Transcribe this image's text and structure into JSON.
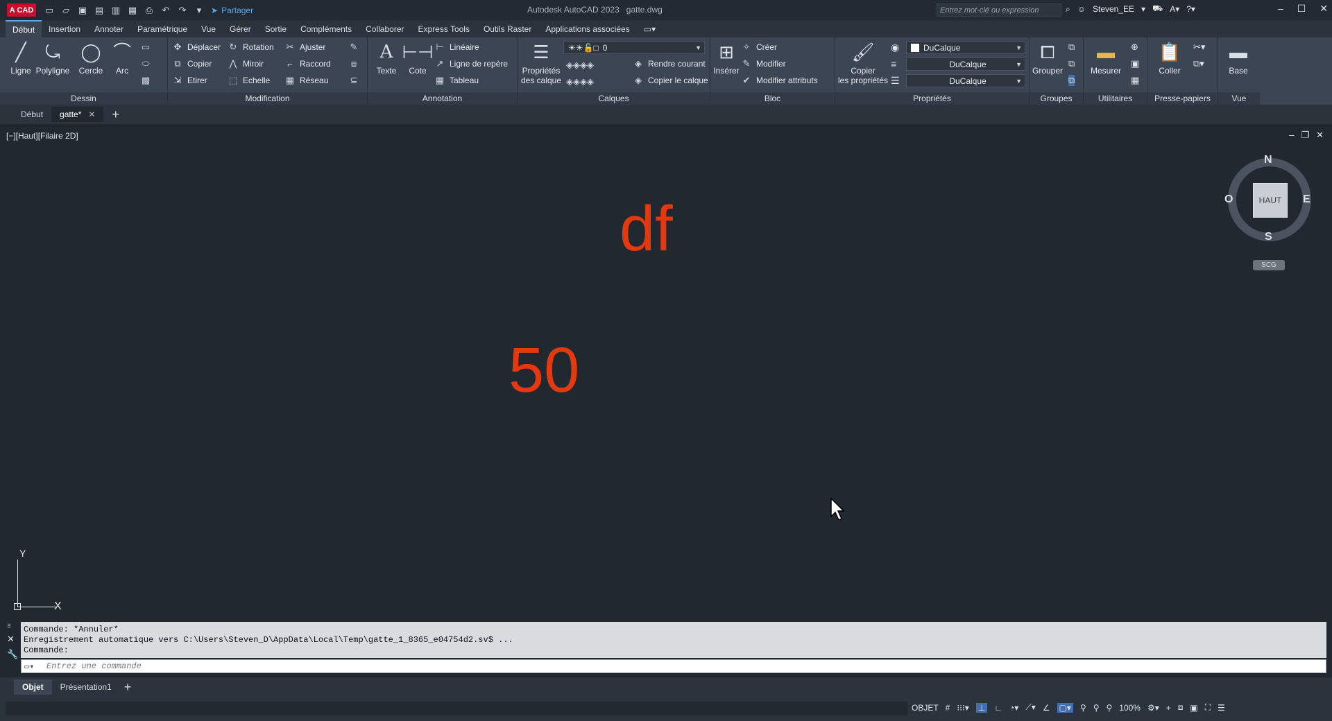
{
  "titlebar": {
    "logo": "A CAD",
    "share_label": "Partager",
    "app_title": "Autodesk AutoCAD 2023",
    "file_name": "gatte.dwg",
    "search_placeholder": "Entrez mot-clé ou expression",
    "user": "Steven_EE"
  },
  "ribbon_tabs": [
    "Début",
    "Insertion",
    "Annoter",
    "Paramétrique",
    "Vue",
    "Gérer",
    "Sortie",
    "Compléments",
    "Collaborer",
    "Express Tools",
    "Outils Raster",
    "Applications associées"
  ],
  "ribbon": {
    "dessin": {
      "title": "Dessin",
      "ligne": "Ligne",
      "polyligne": "Polyligne",
      "cercle": "Cercle",
      "arc": "Arc"
    },
    "modification": {
      "title": "Modification",
      "deplacer": "Déplacer",
      "rotation": "Rotation",
      "ajuster": "Ajuster",
      "copier": "Copier",
      "miroir": "Miroir",
      "raccord": "Raccord",
      "etirer": "Etirer",
      "echelle": "Echelle",
      "reseau": "Réseau"
    },
    "annotation": {
      "title": "Annotation",
      "texte": "Texte",
      "cote": "Cote",
      "lineaire": "Linéaire",
      "ligne_repere": "Ligne de repère",
      "tableau": "Tableau"
    },
    "calques": {
      "title": "Calques",
      "proprietes": "Propriétés\ndes calque",
      "current_layer": "0",
      "rendre_courant": "Rendre courant",
      "copier_calque": "Copier le calque"
    },
    "bloc": {
      "title": "Bloc",
      "inserer": "Insérer",
      "creer": "Créer",
      "modifier": "Modifier",
      "modifier_attributs": "Modifier attributs"
    },
    "proprietes": {
      "title": "Propriétés",
      "copier_props": "Copier\nles propriétés",
      "color": "DuCalque",
      "linetype": "DuCalque",
      "lineweight": "DuCalque"
    },
    "groupes": {
      "title": "Groupes",
      "grouper": "Grouper"
    },
    "utilitaires": {
      "title": "Utilitaires",
      "mesurer": "Mesurer"
    },
    "presse_papiers": {
      "title": "Presse-papiers",
      "coller": "Coller"
    },
    "vue": {
      "title": "Vue",
      "base": "Base"
    }
  },
  "file_tabs": [
    {
      "label": "Début"
    },
    {
      "label": "gatte*"
    }
  ],
  "viewport": {
    "label": "[−][Haut][Filaire 2D]",
    "texts": [
      "df",
      "50"
    ],
    "navcube": {
      "top": "HAUT",
      "n": "N",
      "s": "S",
      "e": "E",
      "w": "O",
      "scg": "SCG"
    },
    "ucs": {
      "x": "X",
      "y": "Y"
    }
  },
  "command": {
    "history": [
      "Commande: *Annuler*",
      "Enregistrement automatique vers C:\\Users\\Steven_D\\AppData\\Local\\Temp\\gatte_1_8365_e04754d2.sv$ ...",
      "Commande:"
    ],
    "placeholder": "Entrez une commande"
  },
  "layout_tabs": [
    "Objet",
    "Présentation1"
  ],
  "status": {
    "mode": "OBJET",
    "zoom": "100%"
  },
  "colors": {
    "accent": "#5aa7e6",
    "draw_text": "#e4390f",
    "logo": "#c8102e"
  }
}
